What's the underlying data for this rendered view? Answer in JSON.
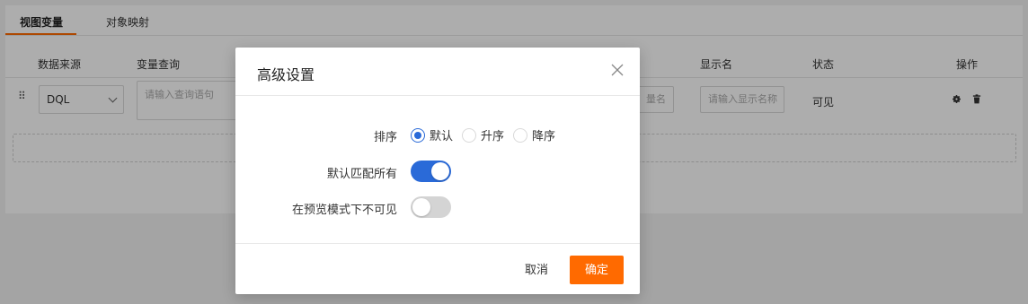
{
  "tabs": [
    {
      "label": "视图变量",
      "active": true
    },
    {
      "label": "对象映射",
      "active": false
    }
  ],
  "table": {
    "headers": {
      "source": "数据来源",
      "query": "变量查询",
      "display_name": "显示名",
      "status": "状态",
      "actions": "操作"
    },
    "row": {
      "source_value": "DQL",
      "query_placeholder": "请输入查询语句",
      "var_name_placeholder": "量名",
      "display_name_placeholder": "请输入显示名称",
      "status": "可见"
    }
  },
  "modal": {
    "title": "高级设置",
    "sort": {
      "label": "排序",
      "options": [
        "默认",
        "升序",
        "降序"
      ],
      "selected_index": 0
    },
    "match_all": {
      "label": "默认匹配所有",
      "on": true
    },
    "hide_in_preview": {
      "label": "在预览模式下不可见",
      "on": false
    },
    "cancel_label": "取消",
    "ok_label": "确定"
  },
  "colors": {
    "accent": "#ff6a00",
    "primary": "#2a6ad8"
  }
}
